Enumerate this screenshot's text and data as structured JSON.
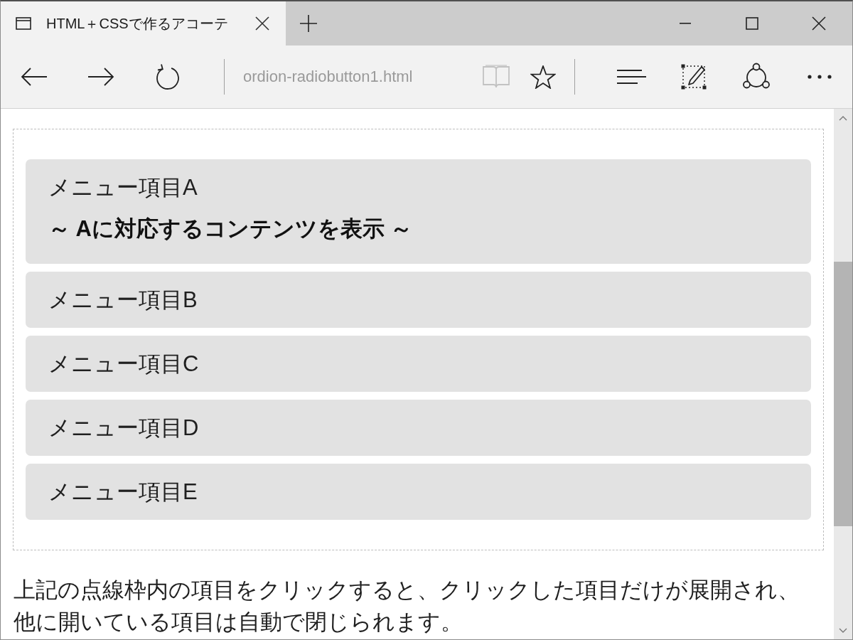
{
  "tabs": [
    {
      "title": "HTML＋CSSで作るアコーテ",
      "selected": true
    }
  ],
  "toolbar": {
    "address": "ordion-radiobutton1.html",
    "reading_view": {
      "disabled": true
    }
  },
  "accordion": {
    "items": [
      {
        "label": "メニュー項目A",
        "expanded": true,
        "content": "～ Aに対応するコンテンツを表示 ～"
      },
      {
        "label": "メニュー項目B",
        "expanded": false
      },
      {
        "label": "メニュー項目C",
        "expanded": false
      },
      {
        "label": "メニュー項目D",
        "expanded": false
      },
      {
        "label": "メニュー項目E",
        "expanded": false
      }
    ]
  },
  "description": "上記の点線枠内の項目をクリックすると、クリックした項目だけが展開され、他に開いている項目は自動で閉じられます。"
}
